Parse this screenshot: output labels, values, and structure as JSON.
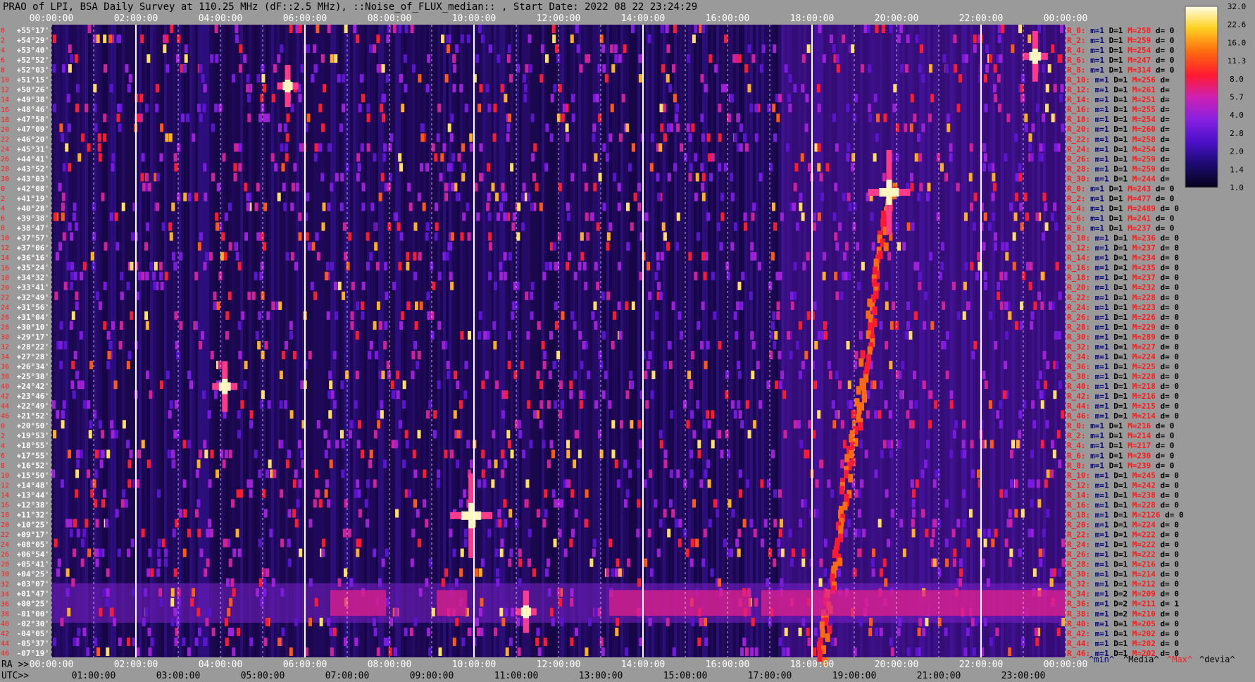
{
  "title": "PRAO of LPI, BSA Daily Survey at 110.25 MHz (dF::2.5 MHz), ::Noise_of_FLUX_median:: , Start Date: 2022 08 22 23:24:29",
  "colors": {
    "background": "#9a9a9a",
    "accent_red": "#ff1a1a",
    "accent_blue": "#00007a",
    "text": "#000000"
  },
  "colorbar_ticks": [
    "32.0",
    "22.6",
    "16.0",
    "11.3",
    "8.0",
    "5.7",
    "4.0",
    "2.8",
    "2.0",
    "1.4",
    "1.0"
  ],
  "legend_footer": [
    {
      "text": "^min^",
      "color": "#00007a"
    },
    {
      "text": "^Media^",
      "color": "#000000"
    },
    {
      "text": "^Max^",
      "color": "#ff1a1a"
    },
    {
      "text": "^devia^",
      "color": "#000000"
    }
  ],
  "left_row_numbers": [
    "0",
    "2",
    "4",
    "6",
    "8",
    "10",
    "12",
    "14",
    "16",
    "18",
    "20",
    "22",
    "24",
    "26",
    "28",
    "30",
    "0",
    "2",
    "4",
    "6",
    "8",
    "10",
    "12",
    "14",
    "16",
    "18",
    "20",
    "22",
    "24",
    "26",
    "28",
    "30",
    "32",
    "34",
    "36",
    "38",
    "40",
    "42",
    "44",
    "46",
    "0",
    "2",
    "4",
    "6",
    "8",
    "10",
    "12",
    "14",
    "16",
    "18",
    "20",
    "22",
    "24",
    "26",
    "28",
    "30",
    "32",
    "34",
    "36",
    "38",
    "40",
    "42",
    "44",
    "46"
  ],
  "chart_data": {
    "type": "heatmap",
    "title": "PRAO of LPI, BSA Daily Survey at 110.25 MHz (dF::2.5 MHz), ::Noise_of_FLUX_median:: , Start Date: 2022 08 22 23:24:29",
    "x_top_ra_ticks": [
      "00:00:00",
      "02:00:00",
      "04:00:00",
      "06:00:00",
      "08:00:00",
      "10:00:00",
      "12:00:00",
      "14:00:00",
      "16:00:00",
      "18:00:00",
      "20:00:00",
      "22:00:00",
      "00:00:00"
    ],
    "x_bottom_ra_label": "RA >>",
    "x_bottom_ra_ticks": [
      "00:00:00",
      "02:00:00",
      "04:00:00",
      "06:00:00",
      "08:00:00",
      "10:00:00",
      "12:00:00",
      "14:00:00",
      "16:00:00",
      "18:00:00",
      "20:00:00",
      "22:00:00",
      "00:00:00"
    ],
    "x_utc_label": "UTC>>",
    "x_utc_ticks": [
      "01:00:00",
      "03:00:00",
      "05:00:00",
      "07:00:00",
      "09:00:00",
      "11:00:00",
      "13:00:00",
      "15:00:00",
      "17:00:00",
      "19:00:00",
      "21:00:00",
      "23:00:00"
    ],
    "y_dec_ticks": [
      "+55°17'",
      "+54°29'",
      "+53°40'",
      "+52°52'",
      "+52°03'",
      "+51°15'",
      "+50°26'",
      "+49°38'",
      "+48°46'",
      "+47°58'",
      "+47°09'",
      "+46°20'",
      "+45°31'",
      "+44°41'",
      "+43°52'",
      "+43°03'",
      "+42°08'",
      "+41°19'",
      "+40°28'",
      "+39°38'",
      "+38°47'",
      "+37°57'",
      "+37°06'",
      "+36°16'",
      "+35°24'",
      "+34°32'",
      "+33°41'",
      "+32°49'",
      "+31°56'",
      "+31°04'",
      "+30°10'",
      "+29°17'",
      "+28°22'",
      "+27°28'",
      "+26°34'",
      "+25°38'",
      "+24°42'",
      "+23°46'",
      "+22°49'",
      "+21°52'",
      "+20°50'",
      "+19°53'",
      "+18°55'",
      "+17°55'",
      "+16°52'",
      "+15°50'",
      "+14°48'",
      "+13°44'",
      "+12°38'",
      "+11°32'",
      "+10°25'",
      "+09°17'",
      "+08°05'",
      "+06°54'",
      "+05°41'",
      "+04°25'",
      "+03°07'",
      "+01°47'",
      "+00°25'",
      "-01°00'",
      "-02°30'",
      "-04°05'",
      "-05°37'",
      "-07°19'"
    ],
    "colorbar": {
      "min": 1.0,
      "max": 32.0,
      "scale": "log",
      "ticks": [
        32.0,
        22.6,
        16.0,
        11.3,
        8.0,
        5.7,
        4.0,
        2.8,
        2.0,
        1.4,
        1.0
      ]
    },
    "grid": "dashed vertical lines, solid white lines every 4 h of RA",
    "row_stats": [
      {
        "r": "R_0:",
        "m": "m=1",
        "d": "D=1",
        "M": "M=258",
        "dev": "d= 0"
      },
      {
        "r": "R_2:",
        "m": "m=1",
        "d": "D=1",
        "M": "M=259",
        "dev": "d= 0"
      },
      {
        "r": "R_4:",
        "m": "m=1",
        "d": "D=1",
        "M": "M=254",
        "dev": "d= 0"
      },
      {
        "r": "R_6:",
        "m": "m=1",
        "d": "D=1",
        "M": "M=247",
        "dev": "d= 0"
      },
      {
        "r": "R_8:",
        "m": "m=1",
        "d": "D=1",
        "M": "M=314",
        "dev": "d= 0"
      },
      {
        "r": "R_10:",
        "m": "m=1",
        "d": "D=1",
        "M": "M=256",
        "dev": "d="
      },
      {
        "r": "R_12:",
        "m": "m=1",
        "d": "D=1",
        "M": "M=261",
        "dev": "d="
      },
      {
        "r": "R_14:",
        "m": "m=1",
        "d": "D=1",
        "M": "M=251",
        "dev": "d="
      },
      {
        "r": "R_16:",
        "m": "m=1",
        "d": "D=1",
        "M": "M=255",
        "dev": "d="
      },
      {
        "r": "R_18:",
        "m": "m=1",
        "d": "D=1",
        "M": "M=254",
        "dev": "d="
      },
      {
        "r": "R_20:",
        "m": "m=1",
        "d": "D=1",
        "M": "M=260",
        "dev": "d="
      },
      {
        "r": "R_22:",
        "m": "m=1",
        "d": "D=1",
        "M": "M=258",
        "dev": "d="
      },
      {
        "r": "R_24:",
        "m": "m=1",
        "d": "D=1",
        "M": "M=254",
        "dev": "d="
      },
      {
        "r": "R_26:",
        "m": "m=1",
        "d": "D=1",
        "M": "M=259",
        "dev": "d="
      },
      {
        "r": "R_28:",
        "m": "m=1",
        "d": "D=1",
        "M": "M=259",
        "dev": "d="
      },
      {
        "r": "R_30:",
        "m": "m=1",
        "d": "D=1",
        "M": "M=244",
        "dev": "d="
      },
      {
        "r": "R_0:",
        "m": "m=1",
        "d": "D=1",
        "M": "M=243",
        "dev": "d= 0"
      },
      {
        "r": "R_2:",
        "m": "m=1",
        "d": "D=1",
        "M": "M=477",
        "dev": "d= 0"
      },
      {
        "r": "R_4:",
        "m": "m=1",
        "d": "D=1",
        "M": "M=2489",
        "dev": "d= 0"
      },
      {
        "r": "R_6:",
        "m": "m=1",
        "d": "D=1",
        "M": "M=241",
        "dev": "d= 0"
      },
      {
        "r": "R_8:",
        "m": "m=1",
        "d": "D=1",
        "M": "M=237",
        "dev": "d= 0"
      },
      {
        "r": "R_10:",
        "m": "m=1",
        "d": "D=1",
        "M": "M=236",
        "dev": "d= 0"
      },
      {
        "r": "R_12:",
        "m": "m=1",
        "d": "D=1",
        "M": "M=237",
        "dev": "d= 0"
      },
      {
        "r": "R_14:",
        "m": "m=1",
        "d": "D=1",
        "M": "M=234",
        "dev": "d= 0"
      },
      {
        "r": "R_16:",
        "m": "m=1",
        "d": "D=1",
        "M": "M=235",
        "dev": "d= 0"
      },
      {
        "r": "R_18:",
        "m": "m=1",
        "d": "D=1",
        "M": "M=237",
        "dev": "d= 0"
      },
      {
        "r": "R_20:",
        "m": "m=1",
        "d": "D=1",
        "M": "M=232",
        "dev": "d= 0"
      },
      {
        "r": "R_22:",
        "m": "m=1",
        "d": "D=1",
        "M": "M=228",
        "dev": "d= 0"
      },
      {
        "r": "R_24:",
        "m": "m=1",
        "d": "D=1",
        "M": "M=223",
        "dev": "d= 0"
      },
      {
        "r": "R_26:",
        "m": "m=1",
        "d": "D=1",
        "M": "M=226",
        "dev": "d= 0"
      },
      {
        "r": "R_28:",
        "m": "m=1",
        "d": "D=1",
        "M": "M=229",
        "dev": "d= 0"
      },
      {
        "r": "R_30:",
        "m": "m=1",
        "d": "D=1",
        "M": "M=289",
        "dev": "d= 0"
      },
      {
        "r": "R_32:",
        "m": "m=1",
        "d": "D=1",
        "M": "M=227",
        "dev": "d= 0"
      },
      {
        "r": "R_34:",
        "m": "m=1",
        "d": "D=1",
        "M": "M=224",
        "dev": "d= 0"
      },
      {
        "r": "R_36:",
        "m": "m=1",
        "d": "D=1",
        "M": "M=225",
        "dev": "d= 0"
      },
      {
        "r": "R_38:",
        "m": "m=1",
        "d": "D=1",
        "M": "M=228",
        "dev": "d= 0"
      },
      {
        "r": "R_40:",
        "m": "m=1",
        "d": "D=1",
        "M": "M=218",
        "dev": "d= 0"
      },
      {
        "r": "R_42:",
        "m": "m=1",
        "d": "D=1",
        "M": "M=216",
        "dev": "d= 0"
      },
      {
        "r": "R_44:",
        "m": "m=1",
        "d": "D=1",
        "M": "M=215",
        "dev": "d= 0"
      },
      {
        "r": "R_46:",
        "m": "m=1",
        "d": "D=1",
        "M": "M=214",
        "dev": "d= 0"
      },
      {
        "r": "R_0:",
        "m": "m=1",
        "d": "D=1",
        "M": "M=216",
        "dev": "d= 0"
      },
      {
        "r": "R_2:",
        "m": "m=1",
        "d": "D=1",
        "M": "M=214",
        "dev": "d= 0"
      },
      {
        "r": "R_4:",
        "m": "m=1",
        "d": "D=1",
        "M": "M=217",
        "dev": "d= 0"
      },
      {
        "r": "R_6:",
        "m": "m=1",
        "d": "D=1",
        "M": "M=230",
        "dev": "d= 0"
      },
      {
        "r": "R_8:",
        "m": "m=1",
        "d": "D=1",
        "M": "M=239",
        "dev": "d= 0"
      },
      {
        "r": "R_10:",
        "m": "m=1",
        "d": "D=1",
        "M": "M=245",
        "dev": "d= 0"
      },
      {
        "r": "R_12:",
        "m": "m=1",
        "d": "D=1",
        "M": "M=242",
        "dev": "d= 0"
      },
      {
        "r": "R_14:",
        "m": "m=1",
        "d": "D=1",
        "M": "M=238",
        "dev": "d= 0"
      },
      {
        "r": "R_16:",
        "m": "m=1",
        "d": "D=1",
        "M": "M=228",
        "dev": "d= 0"
      },
      {
        "r": "R_18:",
        "m": "m=1",
        "d": "D=1",
        "M": "M=2126",
        "dev": "d= 0"
      },
      {
        "r": "R_20:",
        "m": "m=1",
        "d": "D=1",
        "M": "M=224",
        "dev": "d= 0"
      },
      {
        "r": "R_22:",
        "m": "m=1",
        "d": "D=1",
        "M": "M=222",
        "dev": "d= 0"
      },
      {
        "r": "R_24:",
        "m": "m=1",
        "d": "D=1",
        "M": "M=222",
        "dev": "d= 0"
      },
      {
        "r": "R_26:",
        "m": "m=1",
        "d": "D=1",
        "M": "M=222",
        "dev": "d= 0"
      },
      {
        "r": "R_28:",
        "m": "m=1",
        "d": "D=1",
        "M": "M=216",
        "dev": "d= 0"
      },
      {
        "r": "R_30:",
        "m": "m=1",
        "d": "D=1",
        "M": "M=214",
        "dev": "d= 0"
      },
      {
        "r": "R_32:",
        "m": "m=1",
        "d": "D=1",
        "M": "M=212",
        "dev": "d= 0"
      },
      {
        "r": "R_34:",
        "m": "m=1",
        "d": "D=2",
        "M": "M=209",
        "dev": "d= 0"
      },
      {
        "r": "R_36:",
        "m": "m=1",
        "d": "D=2",
        "M": "M=211",
        "dev": "d= 1"
      },
      {
        "r": "R_38:",
        "m": "m=1",
        "d": "D=2",
        "M": "M=210",
        "dev": "d= 0"
      },
      {
        "r": "R_40:",
        "m": "m=1",
        "d": "D=1",
        "M": "M=205",
        "dev": "d= 0"
      },
      {
        "r": "R_42:",
        "m": "m=1",
        "d": "D=1",
        "M": "M=202",
        "dev": "d= 0"
      },
      {
        "r": "R_44:",
        "m": "m=1",
        "d": "D=1",
        "M": "M=202",
        "dev": "d= 0"
      },
      {
        "r": "R_46:",
        "m": "m=1",
        "d": "D=1",
        "M": "M=202",
        "dev": "d= 0"
      }
    ]
  }
}
